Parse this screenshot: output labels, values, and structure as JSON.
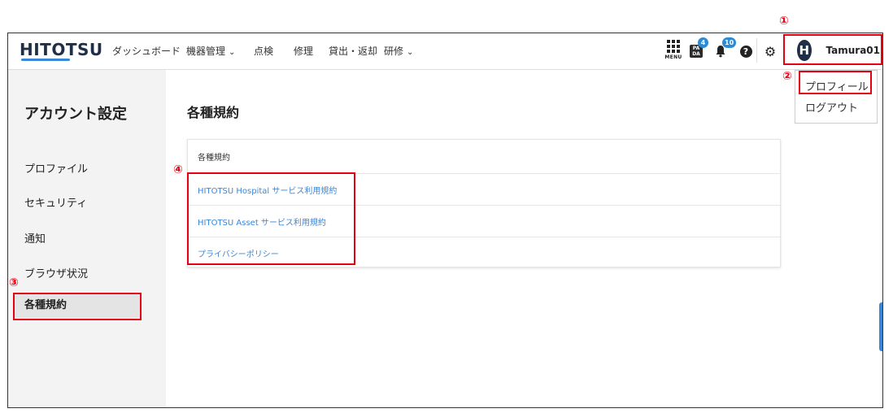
{
  "app": {
    "logo": "HITOTSU"
  },
  "nav": [
    {
      "label": "ダッシュボード",
      "chevron": false
    },
    {
      "label": "機器管理",
      "chevron": true
    },
    {
      "label": "点検",
      "chevron": false
    },
    {
      "label": "修理",
      "chevron": false
    },
    {
      "label": "貸出・返却",
      "chevron": false
    },
    {
      "label": "研修",
      "chevron": true
    }
  ],
  "toolbar": {
    "menu_label": "MENU",
    "pada_icon_text": "PA DA",
    "pada_badge": "4",
    "bell_badge": "10",
    "help_glyph": "?",
    "gear_glyph": "⚙",
    "chevron_glyph": "⌄"
  },
  "user": {
    "avatar_initial": "H",
    "name": "Tamura01"
  },
  "dropdown": {
    "items": [
      "プロフィール",
      "ログアウト"
    ]
  },
  "sidebar": {
    "title": "アカウント設定",
    "items": [
      "プロファイル",
      "セキュリティ",
      "通知",
      "ブラウザ状況",
      "各種規約"
    ]
  },
  "main": {
    "title": "各種規約",
    "card_header": "各種規約",
    "links": [
      "HITOTSU Hospital サービス利用規約",
      "HITOTSU Asset サービス利用規約",
      "プライバシーポリシー"
    ]
  },
  "annotations": {
    "numbers": [
      "①",
      "②",
      "③",
      "④"
    ]
  },
  "colors": {
    "accent": "#3a86d9",
    "brand_dark": "#1f2f4a",
    "callout": "#e60012",
    "badge": "#2b8bd6"
  }
}
